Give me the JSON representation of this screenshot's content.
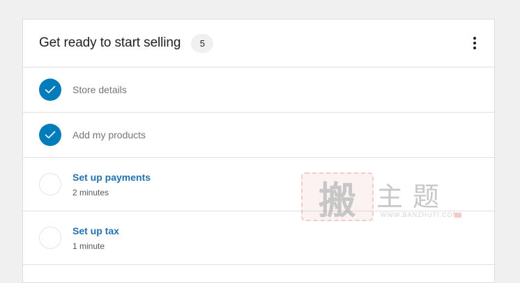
{
  "card": {
    "title": "Get ready to start selling",
    "count": "5",
    "more_icon": "vertical-ellipsis-icon"
  },
  "tasks": [
    {
      "label": "Store details",
      "completed": true,
      "icon": "checkmark-icon"
    },
    {
      "label": "Add my products",
      "completed": true,
      "icon": "checkmark-icon"
    },
    {
      "label": "Set up payments",
      "time": "2 minutes",
      "completed": false
    },
    {
      "label": "Set up tax",
      "time": "1 minute",
      "completed": false
    }
  ],
  "colors": {
    "accent": "#007cba",
    "link": "#2271b1",
    "background": "#f0f0f1"
  },
  "watermark": {
    "seal_text": "搬",
    "text": "主题",
    "url": "WWW.BANZHUTI.COM"
  }
}
